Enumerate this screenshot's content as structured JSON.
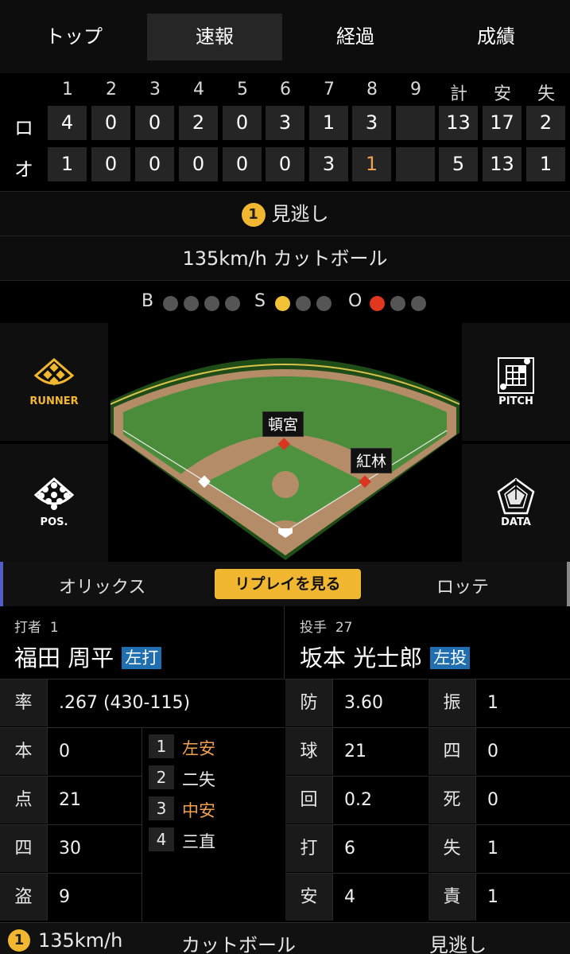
{
  "tabs": [
    "トップ",
    "速報",
    "経過",
    "成績"
  ],
  "scoreboard": {
    "headers": [
      "1",
      "2",
      "3",
      "4",
      "5",
      "6",
      "7",
      "8",
      "9",
      "計",
      "安",
      "失"
    ],
    "teams": [
      {
        "label": "ロ",
        "cells": [
          "4",
          "0",
          "0",
          "2",
          "0",
          "3",
          "1",
          "3",
          "",
          "13",
          "17",
          "2"
        ]
      },
      {
        "label": "オ",
        "cells": [
          "1",
          "0",
          "0",
          "0",
          "0",
          "0",
          "3",
          "1",
          "",
          "5",
          "13",
          "1"
        ]
      }
    ]
  },
  "pitch_result": {
    "number": "1",
    "text": "見逃し"
  },
  "pitch_info": "135km/h カットボール",
  "count": {
    "b_label": "B",
    "s_label": "S",
    "o_label": "O",
    "balls": 0,
    "strikes": 1,
    "outs": 1
  },
  "field": {
    "runner_label": "RUNNER",
    "pitch_label": "PITCH",
    "pos_label": "POS.",
    "data_label": "DATA",
    "runners": {
      "second": "頓宮",
      "first": "紅林"
    }
  },
  "team_bar": {
    "left": "オリックス",
    "replay": "リプレイを見る",
    "right": "ロッテ"
  },
  "batter": {
    "role": "打者",
    "number": "1",
    "name": "福田 周平",
    "hand": "左打",
    "stats": [
      {
        "k": "率",
        "v": ".267 (430-115)"
      },
      {
        "k": "本",
        "v": "0"
      },
      {
        "k": "点",
        "v": "21"
      },
      {
        "k": "四",
        "v": "30"
      },
      {
        "k": "盗",
        "v": "9"
      }
    ],
    "at_bats": [
      {
        "n": "1",
        "t": "左安",
        "hit": true
      },
      {
        "n": "2",
        "t": "二失",
        "hit": false
      },
      {
        "n": "3",
        "t": "中安",
        "hit": true
      },
      {
        "n": "4",
        "t": "三直",
        "hit": false
      }
    ]
  },
  "pitcher": {
    "role": "投手",
    "number": "27",
    "name": "坂本 光士郎",
    "hand": "左投",
    "stats_left": [
      {
        "k": "防",
        "v": "3.60"
      },
      {
        "k": "球",
        "v": "21"
      },
      {
        "k": "回",
        "v": "0.2"
      },
      {
        "k": "打",
        "v": "6"
      },
      {
        "k": "安",
        "v": "4"
      }
    ],
    "stats_right": [
      {
        "k": "振",
        "v": "1"
      },
      {
        "k": "四",
        "v": "0"
      },
      {
        "k": "死",
        "v": "0"
      },
      {
        "k": "失",
        "v": "1"
      },
      {
        "k": "責",
        "v": "1"
      }
    ]
  },
  "bottom_bar": {
    "number": "1",
    "speed": "135km/h",
    "pitch": "カットボール",
    "result": "見逃し"
  }
}
